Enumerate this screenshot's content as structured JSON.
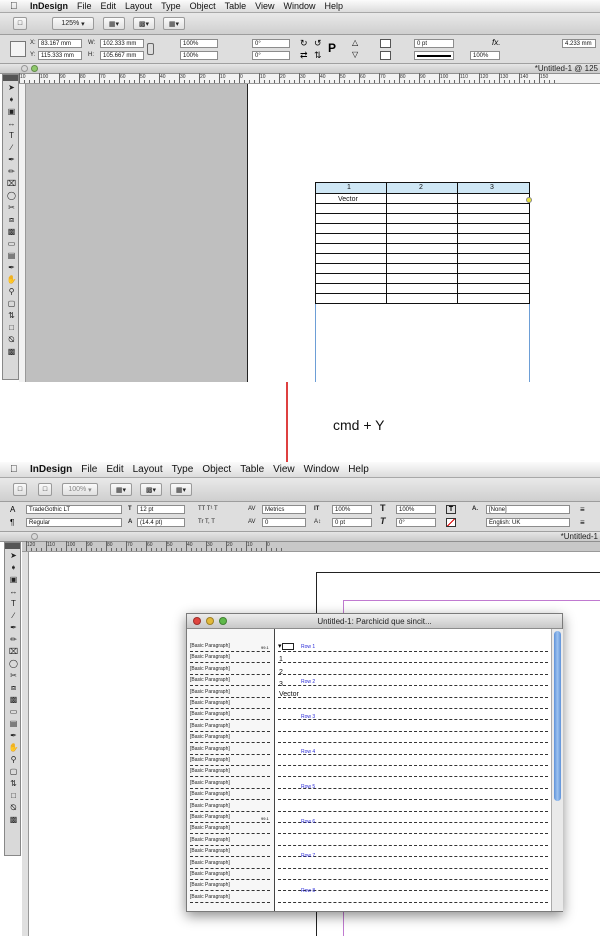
{
  "menu": {
    "app_name": "InDesign",
    "items": [
      "File",
      "Edit",
      "Layout",
      "Type",
      "Object",
      "Table",
      "View",
      "Window",
      "Help"
    ]
  },
  "top": {
    "zoom": "125%",
    "fields": {
      "x": "83.167 mm",
      "y": "115.333 mm",
      "w": "102.333 mm",
      "h": "105.667 mm",
      "scale_x": "100%",
      "scale_y": "100%",
      "angle": "0°",
      "shear": "0°",
      "stroke": "0 pt",
      "opacity": "100%",
      "gap": "4.233 mm"
    },
    "doc_tab": "*Untitled-1 @ 125",
    "ruler_labels": [
      "10",
      "100",
      "90",
      "80",
      "70",
      "60",
      "50",
      "40",
      "30",
      "20",
      "10",
      "0",
      "10",
      "20",
      "30",
      "40",
      "50",
      "60",
      "70",
      "80",
      "90",
      "100",
      "110",
      "120",
      "130",
      "140",
      "150"
    ],
    "table": {
      "headers": [
        "1",
        "2",
        "3"
      ],
      "first_cell": "Vector"
    }
  },
  "shortcut_label": "cmd + Y",
  "bottom": {
    "zoom": "100%",
    "font_family": "TradeGothic LT",
    "font_style": "Regular",
    "font_size": "12 pt",
    "leading": "(14.4 pt)",
    "kerning": "Metrics",
    "tracking": "0",
    "v_scale": "100%",
    "h_scale": "100%",
    "baseline": "0 pt",
    "skew": "0°",
    "char_style": "[None]",
    "language": "English: UK",
    "doc_tab": "*Untitled-1",
    "ruler_labels": [
      "120",
      "110",
      "100",
      "90",
      "80",
      "70",
      "60",
      "50",
      "40",
      "30",
      "20",
      "10",
      "0"
    ],
    "story_editor": {
      "title": "Untitled-1: Parchicid que sincit...",
      "style_label": "[Basic Paragraph]",
      "depth_label": "99.1",
      "cells": [
        "1",
        "2",
        "3",
        "Vector"
      ],
      "rows": [
        "Row 1",
        "Row 2",
        "Row 3",
        "Row 4",
        "Row 5",
        "Row 6",
        "Row 7",
        "Row 8"
      ]
    }
  },
  "colors": {
    "arrow": "#d40000",
    "header_fill": "#cfe7f5",
    "row_label": "#2a2ad8",
    "pasteboard": "#bfbfbf",
    "frame_guide": "#6d9ed6",
    "margin_guide": "#c07ad0"
  }
}
